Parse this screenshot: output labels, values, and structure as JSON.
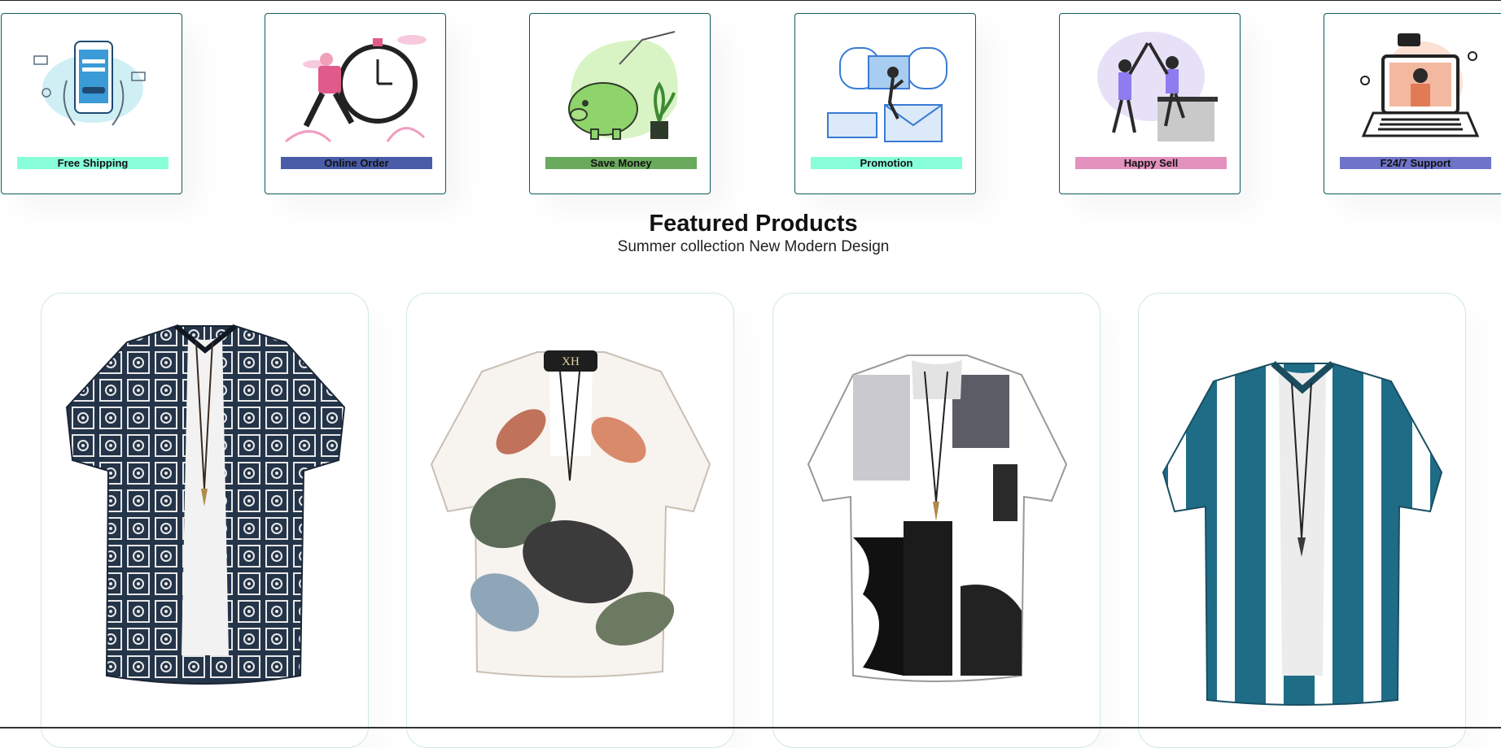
{
  "features": [
    {
      "label": "Free Shipping",
      "color": "#88ffd9",
      "icon": "payment-phone-icon"
    },
    {
      "label": "Online Order",
      "color": "#4a5ca8",
      "icon": "courier-clock-icon"
    },
    {
      "label": "Save Money",
      "color": "#6aaa5c",
      "icon": "piggy-bank-icon"
    },
    {
      "label": "Promotion",
      "color": "#88ffd9",
      "icon": "mail-promotion-icon"
    },
    {
      "label": "Happy Sell",
      "color": "#e391bd",
      "icon": "high-five-icon"
    },
    {
      "label": "F24/7 Support",
      "color": "#6f74c9",
      "icon": "laptop-support-icon"
    }
  ],
  "featured": {
    "title": "Featured Products",
    "subtitle": "Summer collection New Modern Design"
  },
  "products": [
    {
      "image": "navy-bandana-print-shirt",
      "colors": [
        "#243449",
        "#f2f2f2"
      ]
    },
    {
      "image": "tropical-leaf-print-shirt",
      "colors": [
        "#d98a6b",
        "#5c6b57"
      ]
    },
    {
      "image": "black-white-patchwork-shirt",
      "colors": [
        "#111111",
        "#c9c9cf"
      ]
    },
    {
      "image": "teal-white-striped-shirt",
      "colors": [
        "#1f6c86",
        "#ffffff"
      ]
    }
  ]
}
